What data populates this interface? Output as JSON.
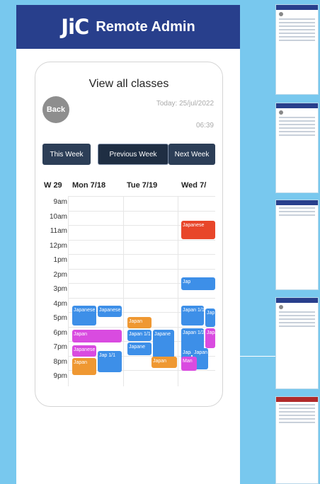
{
  "header": {
    "logo_text": "JiC",
    "title": "Remote Admin"
  },
  "card": {
    "title": "View all classes",
    "back_label": "Back",
    "today": "Today: 25/jul/2022",
    "time": "06:39"
  },
  "week_nav": {
    "this_week": "This Week",
    "previous_week": "Previous Week",
    "next_week": "Next Week"
  },
  "calendar": {
    "week_label": "W 29",
    "days": [
      "Mon 7/18",
      "Tue 7/19",
      "Wed 7/"
    ],
    "hours": [
      "9am",
      "10am",
      "11am",
      "12pm",
      "1pm",
      "2pm",
      "3pm",
      "4pm",
      "5pm",
      "6pm",
      "7pm",
      "8pm",
      "9pm"
    ],
    "events": [
      {
        "label": "Japanese 1/1",
        "color": "#3d8fe8"
      },
      {
        "label": "Japanese",
        "color": "#3d8fe8"
      },
      {
        "label": "Japanese",
        "color": "#e8462a"
      },
      {
        "label": "Japan 1/1",
        "color": "#3d8fe8"
      },
      {
        "label": "Japan",
        "color": "#ef9832"
      },
      {
        "label": "Japan 1/1",
        "color": "#3d8fe8"
      },
      {
        "label": "Jap",
        "color": "#3d8fe8"
      },
      {
        "label": "Japane",
        "color": "#3d8fe8"
      },
      {
        "label": "Japan 1/2",
        "color": "#3d8fe8"
      },
      {
        "label": "Japan 1/1",
        "color": "#d94be0"
      },
      {
        "label": "Japan",
        "color": "#d94be0"
      },
      {
        "label": "Japanese 1/",
        "color": "#d94be0"
      },
      {
        "label": "Jap 1/1",
        "color": "#3d8fe8"
      },
      {
        "label": "Japane",
        "color": "#3d8fe8"
      },
      {
        "label": "Japan",
        "color": "#ef9832"
      },
      {
        "label": "Japan",
        "color": "#ef9832"
      },
      {
        "label": "Japan 1/1",
        "color": "#3d8fe8"
      },
      {
        "label": "Japan 1/1",
        "color": "#3d8fe8"
      },
      {
        "label": "Jap",
        "color": "#3d8fe8"
      },
      {
        "label": "Man",
        "color": "#d94be0"
      }
    ]
  },
  "colors": {
    "background": "#78c8ee",
    "header": "#283f8c",
    "button": "#2c3e57"
  }
}
